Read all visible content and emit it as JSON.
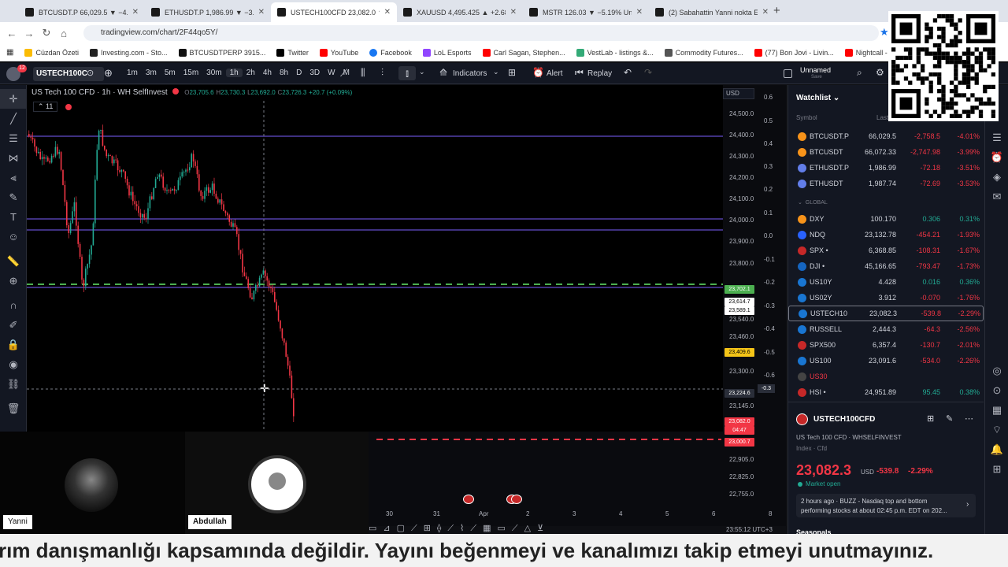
{
  "browser": {
    "tabs": [
      {
        "label": "BTCUSDT.P 66,029.5 ▼ −4.01%",
        "active": false
      },
      {
        "label": "ETHUSDT.P 1,986.99 ▼ −3.51%",
        "active": false
      },
      {
        "label": "USTECH100CFD 23,082.0 ▼ −2...",
        "active": true
      },
      {
        "label": "XAUUSD 4,495.425 ▲ +2.68% U...",
        "active": false
      },
      {
        "label": "MSTR 126.03 ▼ −5.19% Unnam...",
        "active": false
      },
      {
        "label": "(2) Sabahattin Yanni nokta Eteh...",
        "active": false
      }
    ],
    "url": "tradingview.com/chart/2F44qo5Y/",
    "bookmarks": [
      "Cüzdan Özeti",
      "Investing.com - Sto...",
      "BTCUSDTPERP 3915...",
      "Twitter",
      "YouTube",
      "Facebook",
      "LoL Esports",
      "Carl Sagan, Stephen...",
      "VestLab - listings &...",
      "Commodity Futures...",
      "(77) Bon Jovi - Livin...",
      "Nightcall - YouTube"
    ]
  },
  "toolbar": {
    "symbol": "USTECH100C",
    "notification_count": "12",
    "intervals": [
      "1m",
      "3m",
      "5m",
      "15m",
      "30m",
      "1h",
      "2h",
      "4h",
      "8h",
      "D",
      "3D",
      "W",
      "M"
    ],
    "selected_interval": "1h",
    "indicators_label": "Indicators",
    "alert_label": "Alert",
    "replay_label": "Replay",
    "layout_name": "Unnamed",
    "layout_status": "Save"
  },
  "chart": {
    "title": "US Tech 100 CFD · 1h · WH SelfInvest",
    "ohlc": {
      "o": "23,705.6",
      "h": "23,730.3",
      "l": "23,692.0",
      "c": "23,726.3",
      "change": "+20.7 (+0.09%)"
    },
    "indicator_count": "11",
    "currency": "USD",
    "colors": {
      "up": "#22ab94",
      "down": "#f23645",
      "level_line": "#7b61ff",
      "green_dash": "#4caf50",
      "red_dash": "#f23645"
    }
  },
  "chart_data": {
    "type": "candlestick",
    "y_axis_labels": [
      "24,500.0",
      "24,400.0",
      "24,300.0",
      "24,200.0",
      "24,100.0",
      "24,000.0",
      "23,900.0",
      "23,800.0",
      "23,540.0",
      "23,460.0",
      "23,380.0",
      "23,300.0",
      "23,145.0",
      "22,905.0",
      "22,825.0",
      "22,755.0"
    ],
    "pct_axis_labels": [
      "0.6",
      "0.5",
      "0.4",
      "0.3",
      "0.2",
      "0.1",
      "0.0",
      "-0.1",
      "-0.2",
      "-0.3",
      "-0.4",
      "-0.5",
      "-0.6"
    ],
    "x_axis_labels": [
      "30",
      "31",
      "Apr",
      "2",
      "3",
      "4",
      "5",
      "6",
      "8"
    ],
    "price_tags": [
      {
        "label": "23,702.1",
        "color": "#4caf50"
      },
      {
        "label": "23,614.7",
        "color": "#ffffff"
      },
      {
        "label": "23,589.1",
        "color": "#ffffff"
      },
      {
        "label": "23,409.6",
        "color": "#f5c518"
      },
      {
        "label": "23,224.6",
        "color": "#2a2e39"
      },
      {
        "label": "23,082.0",
        "color": "#f23645"
      },
      {
        "label": "04:47",
        "color": "#f23645"
      },
      {
        "label": "23,000.7",
        "color": "#f23645"
      }
    ],
    "crosshair_pct": "-0.3",
    "clock": "23:55:12 UTC+3"
  },
  "video": {
    "participants": [
      "Yanni",
      "Abdullah"
    ]
  },
  "watchlist": {
    "title": "Watchlist",
    "col_symbol": "Symbol",
    "col_last": "Last",
    "section_global": "GLOBAL",
    "rows": [
      {
        "sym": "BTCUSDT.P",
        "last": "66,029.5",
        "chg": "-2,758.5",
        "pct": "-4.01%",
        "dir": "down",
        "icon": "#f7931a"
      },
      {
        "sym": "BTCUSDT",
        "last": "66,072.33",
        "chg": "-2,747.98",
        "pct": "-3.99%",
        "dir": "down",
        "icon": "#f7931a"
      },
      {
        "sym": "ETHUSDT.P",
        "last": "1,986.99",
        "chg": "-72.18",
        "pct": "-3.51%",
        "dir": "down",
        "icon": "#627eea"
      },
      {
        "sym": "ETHUSDT",
        "last": "1,987.74",
        "chg": "-72.69",
        "pct": "-3.53%",
        "dir": "down",
        "icon": "#627eea"
      },
      {
        "sym": "DXY",
        "last": "100.170",
        "chg": "0.306",
        "pct": "0.31%",
        "dir": "up",
        "icon": "#f7931a"
      },
      {
        "sym": "NDQ",
        "last": "23,132.78",
        "chg": "-454.21",
        "pct": "-1.93%",
        "dir": "down",
        "icon": "#2962ff"
      },
      {
        "sym": "SPX •",
        "last": "6,368.85",
        "chg": "-108.31",
        "pct": "-1.67%",
        "dir": "down",
        "icon": "#c62828"
      },
      {
        "sym": "DJI •",
        "last": "45,166.65",
        "chg": "-793.47",
        "pct": "-1.73%",
        "dir": "down",
        "icon": "#1565c0"
      },
      {
        "sym": "US10Y",
        "last": "4.428",
        "chg": "0.016",
        "pct": "0.36%",
        "dir": "up",
        "icon": "#1976d2"
      },
      {
        "sym": "US02Y",
        "last": "3.912",
        "chg": "-0.070",
        "pct": "-1.76%",
        "dir": "down",
        "icon": "#1976d2"
      },
      {
        "sym": "USTECH10",
        "last": "23,082.3",
        "chg": "-539.8",
        "pct": "-2.29%",
        "dir": "down",
        "icon": "#1976d2"
      },
      {
        "sym": "RUSSELL",
        "last": "2,444.3",
        "chg": "-64.3",
        "pct": "-2.56%",
        "dir": "down",
        "icon": "#1976d2"
      },
      {
        "sym": "SPX500",
        "last": "6,357.4",
        "chg": "-130.7",
        "pct": "-2.01%",
        "dir": "down",
        "icon": "#c62828"
      },
      {
        "sym": "US100",
        "last": "23,091.6",
        "chg": "-534.0",
        "pct": "-2.26%",
        "dir": "down",
        "icon": "#1976d2"
      },
      {
        "sym": "US30",
        "last": "",
        "chg": "",
        "pct": "",
        "dir": "down",
        "icon": "#444"
      },
      {
        "sym": "HSI •",
        "last": "24,951.89",
        "chg": "95.45",
        "pct": "0.38%",
        "dir": "up",
        "icon": "#c62828"
      }
    ]
  },
  "detail": {
    "symbol": "USTECH100CFD",
    "desc": "US Tech 100 CFD · WHSELFINVEST",
    "type": "Index · Cfd",
    "price": "23,082.3",
    "currency": "USD",
    "change": "-539.8",
    "change_pct": "-2.29%",
    "market_status": "Market open",
    "news_time": "2 hours ago · BUZZ - Nasdaq top and bottom",
    "news_text": "performing stocks at about 02:45 p.m. EDT on 202...",
    "seasonals": "Seasonals"
  },
  "caption": "rım danışmanlığı kapsamında değildir. Yayını beğenmeyi ve kanalımızı takip etmeyi unutmayınız."
}
